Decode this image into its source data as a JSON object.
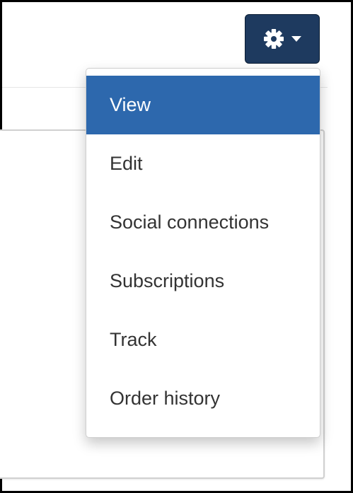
{
  "toolbar": {
    "settings_icon": "gear-icon",
    "caret_icon": "caret-down-icon",
    "button_color": "#1e3a5f"
  },
  "menu": {
    "items": [
      {
        "label": "View",
        "active": true
      },
      {
        "label": "Edit",
        "active": false
      },
      {
        "label": "Social connections",
        "active": false
      },
      {
        "label": "Subscriptions",
        "active": false
      },
      {
        "label": "Track",
        "active": false
      },
      {
        "label": "Order history",
        "active": false
      }
    ],
    "active_color": "#2d68ad"
  }
}
